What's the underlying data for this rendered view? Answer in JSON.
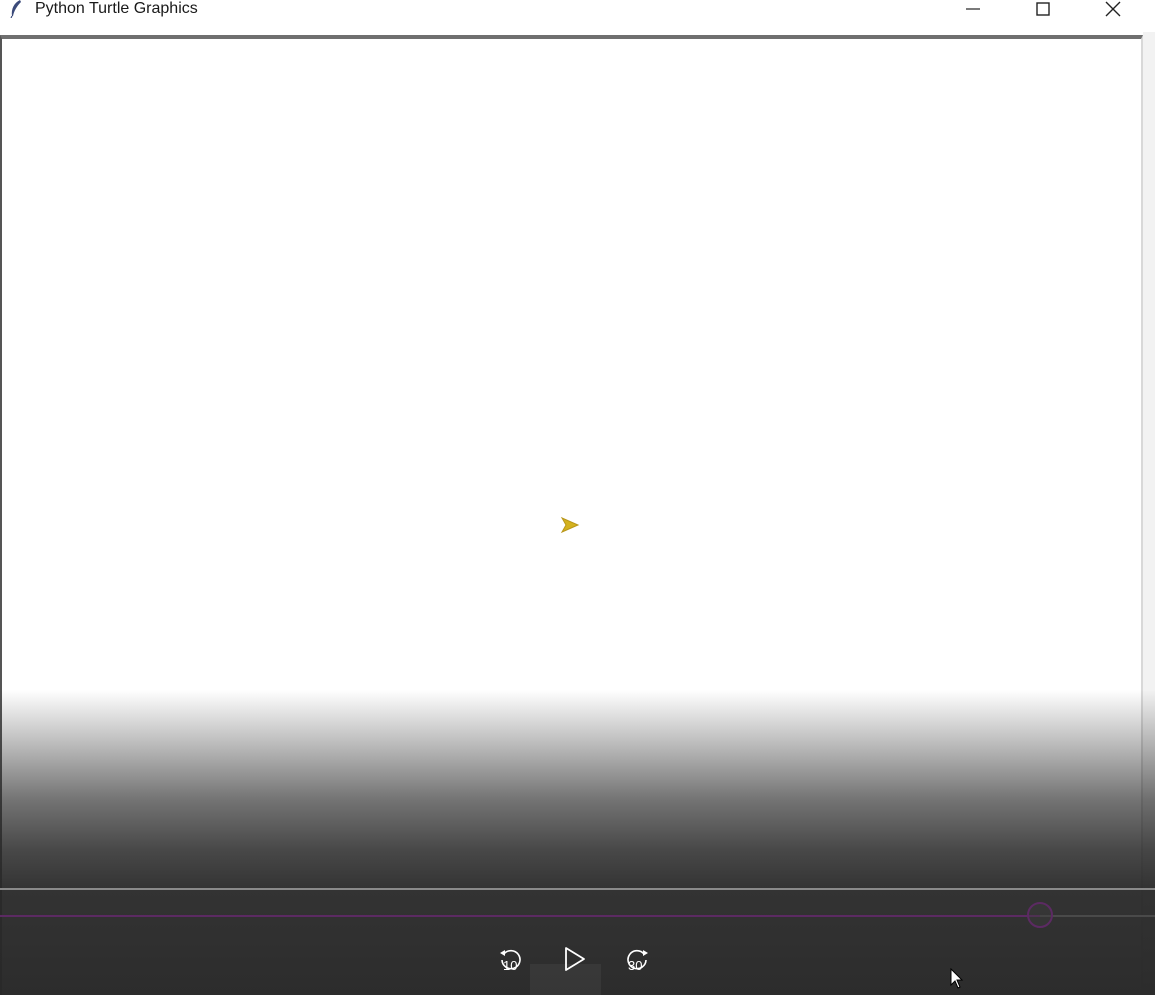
{
  "window": {
    "title": "Python Turtle Graphics",
    "icon": "feather-icon",
    "controls": [
      "minimize-icon",
      "maximize-icon",
      "close-icon"
    ]
  },
  "canvas": {
    "background": "#ffffff",
    "turtle": {
      "shape": "arrow",
      "color": "#d4b21e",
      "heading": "east"
    }
  },
  "player": {
    "progress": 0.9,
    "accent": "#5c2a63",
    "rewind": {
      "icon": "rewind-icon",
      "label": "10"
    },
    "play": {
      "icon": "play-icon"
    },
    "forward": {
      "icon": "forward-icon",
      "label": "30"
    }
  }
}
